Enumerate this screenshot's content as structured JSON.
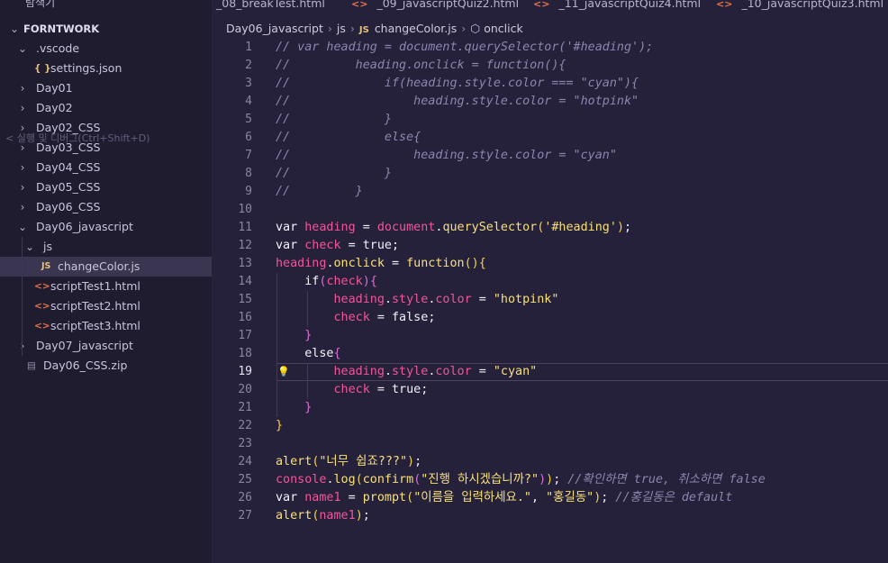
{
  "sidebar": {
    "title": "탐색기",
    "more": "···",
    "root": "FORNTWORK",
    "tooltip": "< 실행 및 디버그(Ctrl+Shift+D)",
    "items": [
      {
        "label": ".vscode",
        "type": "folder",
        "expanded": true,
        "depth": 1
      },
      {
        "label": "settings.json",
        "type": "json",
        "icon": "{ }",
        "depth": 2
      },
      {
        "label": "Day01",
        "type": "folder",
        "expanded": false,
        "depth": 1
      },
      {
        "label": "Day02",
        "type": "folder",
        "expanded": false,
        "depth": 1
      },
      {
        "label": "Day02_CSS",
        "type": "folder",
        "expanded": false,
        "depth": 1
      },
      {
        "label": "Day03_CSS",
        "type": "folder",
        "expanded": false,
        "depth": 1
      },
      {
        "label": "Day04_CSS",
        "type": "folder",
        "expanded": false,
        "depth": 1
      },
      {
        "label": "Day05_CSS",
        "type": "folder",
        "expanded": false,
        "depth": 1
      },
      {
        "label": "Day06_CSS",
        "type": "folder",
        "expanded": false,
        "depth": 1
      },
      {
        "label": "Day06_javascript",
        "type": "folder",
        "expanded": true,
        "depth": 1
      },
      {
        "label": "js",
        "type": "folder",
        "expanded": true,
        "depth": 2
      },
      {
        "label": "changeColor.js",
        "type": "js",
        "icon": "JS",
        "depth": 3,
        "selected": true
      },
      {
        "label": "scriptTest1.html",
        "type": "html",
        "icon": "<>",
        "depth": 2
      },
      {
        "label": "scriptTest2.html",
        "type": "html",
        "icon": "<>",
        "depth": 2
      },
      {
        "label": "scriptTest3.html",
        "type": "html",
        "icon": "<>",
        "depth": 2
      },
      {
        "label": "Day07_javascript",
        "type": "folder",
        "expanded": false,
        "depth": 1
      },
      {
        "label": "Day06_CSS.zip",
        "type": "zip",
        "icon": "▤",
        "depth": 1
      }
    ]
  },
  "tabs": [
    {
      "label": "_08_breakTest.html",
      "icon": ""
    },
    {
      "label": "_09_javascriptQuiz2.html",
      "icon": "<>"
    },
    {
      "label": "_11_javascriptQuiz4.html",
      "icon": "<>"
    },
    {
      "label": "_10_javascriptQuiz3.html",
      "icon": "<>"
    }
  ],
  "breadcrumb": {
    "folder": "Day06_javascript",
    "subfolder": "js",
    "file_icon": "JS",
    "file": "changeColor.js",
    "symbol_icon": "⬡",
    "symbol": "onclick"
  },
  "editor": {
    "current_line": 19,
    "lines": [
      [
        [
          "com",
          "// var heading = document.querySelector('#heading');"
        ]
      ],
      [
        [
          "com",
          "//         heading.onclick = function(){"
        ]
      ],
      [
        [
          "com",
          "//             if(heading.style.color === \"cyan\"){"
        ]
      ],
      [
        [
          "com",
          "//                 heading.style.color = \"hotpink\""
        ]
      ],
      [
        [
          "com",
          "//             }"
        ]
      ],
      [
        [
          "com",
          "//             else{"
        ]
      ],
      [
        [
          "com",
          "//                 heading.style.color = \"cyan\""
        ]
      ],
      [
        [
          "com",
          "//             }"
        ]
      ],
      [
        [
          "com",
          "//         }"
        ]
      ],
      [],
      [
        [
          "kw",
          "var "
        ],
        [
          "var",
          "heading"
        ],
        [
          "plain",
          " = "
        ],
        [
          "var",
          "document"
        ],
        [
          "plain",
          "."
        ],
        [
          "fn",
          "querySelector"
        ],
        [
          "br1",
          "("
        ],
        [
          "str",
          "'#heading'"
        ],
        [
          "br1",
          ")"
        ],
        [
          "plain",
          ";"
        ]
      ],
      [
        [
          "kw",
          "var "
        ],
        [
          "var",
          "check"
        ],
        [
          "plain",
          " = "
        ],
        [
          "bool",
          "true"
        ],
        [
          "plain",
          ";"
        ]
      ],
      [
        [
          "var",
          "heading"
        ],
        [
          "plain",
          "."
        ],
        [
          "fn",
          "onclick"
        ],
        [
          "plain",
          " = "
        ],
        [
          "fn",
          "function"
        ],
        [
          "br1",
          "()"
        ],
        [
          "br1",
          "{"
        ]
      ],
      [
        [
          "plain",
          "    "
        ],
        [
          "kw",
          "if"
        ],
        [
          "br2",
          "("
        ],
        [
          "var",
          "check"
        ],
        [
          "br2",
          ")"
        ],
        [
          "br2",
          "{"
        ]
      ],
      [
        [
          "plain",
          "        "
        ],
        [
          "var",
          "heading"
        ],
        [
          "plain",
          "."
        ],
        [
          "prop",
          "style"
        ],
        [
          "plain",
          "."
        ],
        [
          "var",
          "color"
        ],
        [
          "plain",
          " = "
        ],
        [
          "str",
          "\"hotpink\""
        ]
      ],
      [
        [
          "plain",
          "        "
        ],
        [
          "var",
          "check"
        ],
        [
          "plain",
          " = "
        ],
        [
          "bool",
          "false"
        ],
        [
          "plain",
          ";"
        ]
      ],
      [
        [
          "plain",
          "    "
        ],
        [
          "br2",
          "}"
        ]
      ],
      [
        [
          "plain",
          "    "
        ],
        [
          "kw",
          "else"
        ],
        [
          "br2",
          "{"
        ]
      ],
      [
        [
          "plain",
          "        "
        ],
        [
          "var",
          "heading"
        ],
        [
          "plain",
          "."
        ],
        [
          "prop",
          "style"
        ],
        [
          "plain",
          "."
        ],
        [
          "var",
          "color"
        ],
        [
          "plain",
          " = "
        ],
        [
          "str",
          "\"cyan\""
        ]
      ],
      [
        [
          "plain",
          "        "
        ],
        [
          "var",
          "check"
        ],
        [
          "plain",
          " = "
        ],
        [
          "bool",
          "true"
        ],
        [
          "plain",
          ";"
        ]
      ],
      [
        [
          "plain",
          "    "
        ],
        [
          "br2",
          "}"
        ]
      ],
      [
        [
          "br1",
          "}"
        ]
      ],
      [],
      [
        [
          "fn",
          "alert"
        ],
        [
          "br1",
          "("
        ],
        [
          "str",
          "\"너무 쉽죠???\""
        ],
        [
          "br1",
          ")"
        ],
        [
          "plain",
          ";"
        ]
      ],
      [
        [
          "var",
          "console"
        ],
        [
          "plain",
          "."
        ],
        [
          "fn",
          "log"
        ],
        [
          "br1",
          "("
        ],
        [
          "fn",
          "confirm"
        ],
        [
          "br2",
          "("
        ],
        [
          "str",
          "\"진행 하시겠습니까?\""
        ],
        [
          "br2",
          ")"
        ],
        [
          "br1",
          ")"
        ],
        [
          "plain",
          "; "
        ],
        [
          "com",
          "//확인하면 true, 취소하면 false"
        ]
      ],
      [
        [
          "kw",
          "var "
        ],
        [
          "var",
          "name1"
        ],
        [
          "plain",
          " = "
        ],
        [
          "fn",
          "prompt"
        ],
        [
          "br1",
          "("
        ],
        [
          "str",
          "\"이름을 입력하세요.\""
        ],
        [
          "plain",
          ", "
        ],
        [
          "str",
          "\"홍길동\""
        ],
        [
          "br1",
          ")"
        ],
        [
          "plain",
          "; "
        ],
        [
          "com",
          "//홍길동은 default"
        ]
      ],
      [
        [
          "fn",
          "alert"
        ],
        [
          "br1",
          "("
        ],
        [
          "var",
          "name1"
        ],
        [
          "br1",
          ")"
        ],
        [
          "plain",
          ";"
        ]
      ]
    ]
  },
  "colors": {
    "background": "#26213a",
    "sidebar": "#201c30",
    "keyword": "#f6f3ff",
    "variable": "#f0569a",
    "function": "#f7e07a",
    "string": "#f7e07a",
    "comment": "#8a86ad"
  }
}
